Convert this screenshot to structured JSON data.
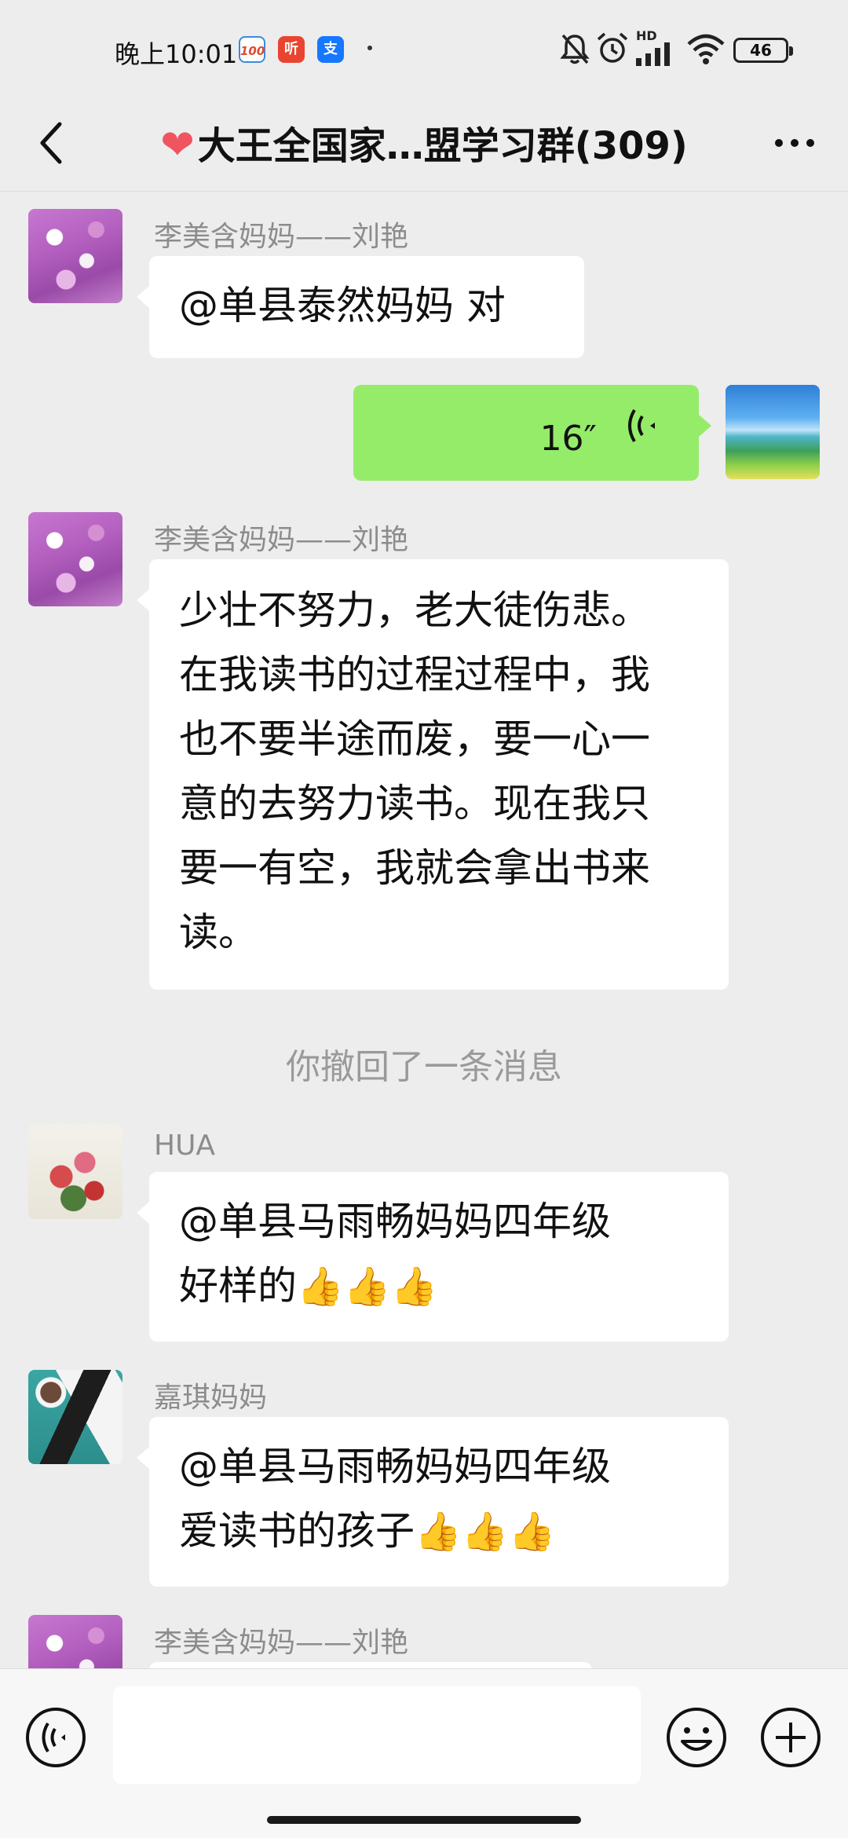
{
  "status_bar": {
    "time": "晚上10:01",
    "app_icons": [
      "100-app-icon",
      "ting-app-icon",
      "alipay-app-icon"
    ],
    "icons": [
      "mute-bell-icon",
      "alarm-icon",
      "hd-signal-icon",
      "wifi-icon"
    ],
    "hd_label": "HD",
    "battery": "46"
  },
  "header": {
    "title": "大王全国家…盟学习群(309)",
    "title_prefix_icon": "heart-emoji",
    "back_icon": "chevron-left-icon",
    "more_icon": "more-dots-icon"
  },
  "messages": [
    {
      "type": "text",
      "side": "left",
      "sender": "李美含妈妈——刘艳",
      "avatar": "flower-avatar",
      "text": "@单县泰然妈妈  对"
    },
    {
      "type": "voice",
      "side": "right",
      "avatar": "landscape-avatar",
      "duration": "16″"
    },
    {
      "type": "text",
      "side": "left",
      "sender": "李美含妈妈——刘艳",
      "avatar": "flower-avatar",
      "lines": [
        "少壮不努力，老大徒伤悲。",
        "在我读书的过程过程中，我",
        "也不要半途而废，要一心一",
        "意的去努力读书。现在我只",
        "要一有空，我就会拿出书来",
        "读。"
      ]
    },
    {
      "type": "system",
      "text": "你撤回了一条消息"
    },
    {
      "type": "text",
      "side": "left",
      "sender": "HUA",
      "avatar": "peony-avatar",
      "lines": [
        "@单县马雨畅妈妈四年级",
        "好样的"
      ],
      "emoji": "👍👍👍"
    },
    {
      "type": "text",
      "side": "left",
      "sender": "嘉琪妈妈",
      "avatar": "desk-avatar",
      "lines": [
        "@单县马雨畅妈妈四年级",
        "爱读书的孩子"
      ],
      "emoji": "👍👍👍"
    },
    {
      "type": "text",
      "side": "left",
      "sender": "李美含妈妈——刘艳",
      "avatar": "flower-avatar",
      "text": ""
    }
  ],
  "input_bar": {
    "voice_button_icon": "voice-input-icon",
    "input_value": "",
    "emoji_button_icon": "smiley-icon",
    "plus_button_icon": "plus-circle-icon"
  }
}
